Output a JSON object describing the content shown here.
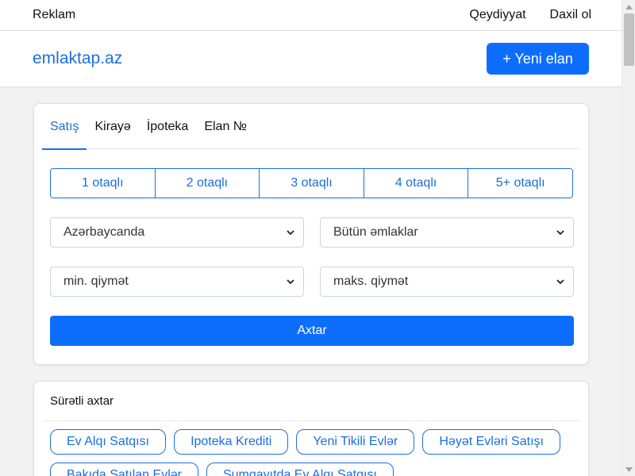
{
  "topbar": {
    "ads_label": "Reklam",
    "register_label": "Qeydiyyat",
    "login_label": "Daxil ol"
  },
  "header": {
    "logo": "emlaktap.az",
    "new_ad_label": "+ Yeni elan"
  },
  "search": {
    "tabs": [
      {
        "label": "Satış",
        "active": true
      },
      {
        "label": "Kirayə",
        "active": false
      },
      {
        "label": "İpoteka",
        "active": false
      },
      {
        "label": "Elan №",
        "active": false
      }
    ],
    "rooms": [
      "1 otaqlı",
      "2 otaqlı",
      "3 otaqlı",
      "4 otaqlı",
      "5+ otaqlı"
    ],
    "location_select": "Azərbaycanda",
    "property_type_select": "Bütün əmlaklar",
    "min_price_select": "min. qiymət",
    "max_price_select": "maks. qiymət",
    "submit_label": "Axtar"
  },
  "quick_search": {
    "title": "Sürətli axtar",
    "chips": [
      "Ev Alqı Satqısı",
      "Ipoteka Krediti",
      "Yeni Tikili Evlər",
      "Həyət Evləri Satışı",
      "Bakıda Satılan Evlər",
      "Sumqayıtda Ev Alqı Satqısı"
    ]
  },
  "colors": {
    "accent": "#0d6efd",
    "link": "#1a6fe0",
    "background": "#f2f2f2"
  },
  "icons": {
    "select_chevron": "chevron-down-icon"
  }
}
